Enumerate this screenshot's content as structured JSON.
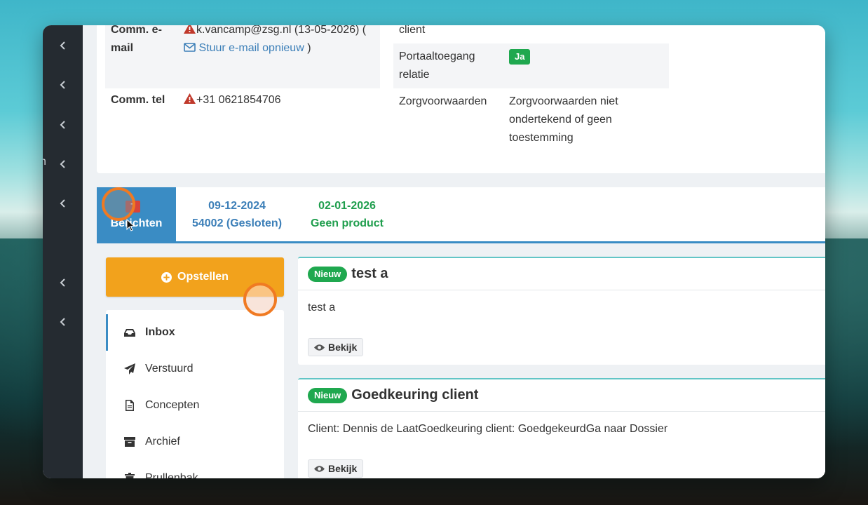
{
  "sidebar": {
    "partial_label": "n",
    "items": [
      "chevron-left",
      "chevron-left",
      "chevron-left",
      "chevron-left",
      "chevron-left",
      "chevron-left",
      "chevron-left"
    ]
  },
  "info": {
    "comm_email_label": "Comm. e-mail",
    "comm_email_value": "k.vancamp@zsg.nl (13-05-2026) (",
    "resend_link": "Stuur e-mail opnieuw",
    "resend_close": ")",
    "comm_tel_label": "Comm. tel",
    "comm_tel_value": "+31 0621854706",
    "client_label": "client",
    "portal_label": "Portaaltoegang relatie",
    "portal_value": "Ja",
    "zorg_label": "Zorgvoorwaarden",
    "zorg_value": "Zorgvoorwaarden niet ondertekend of geen toestemming"
  },
  "tabs": [
    {
      "count": "7",
      "label": "Berichten"
    },
    {
      "line1": "09-12-2024",
      "line2": "54002 (Gesloten)"
    },
    {
      "line1": "02-01-2026",
      "line2": "Geen product"
    }
  ],
  "compose_label": "Opstellen",
  "folders": [
    "Inbox",
    "Verstuurd",
    "Concepten",
    "Archief",
    "Prullenbak"
  ],
  "messages": [
    {
      "badge": "Nieuw",
      "title": "test a",
      "body": "test a",
      "action": "Bekijk"
    },
    {
      "badge": "Nieuw",
      "title": "Goedkeuring client",
      "body": "Client: Dennis de LaatGoedkeuring client: GoedgekeurdGa naar Dossier",
      "action": "Bekijk"
    }
  ],
  "colors": {
    "accent_blue": "#3a8cc4",
    "compose_orange": "#f2a21c",
    "badge_green": "#1fa84f",
    "count_red": "#d9443a",
    "click_ring": "#f07a22"
  }
}
